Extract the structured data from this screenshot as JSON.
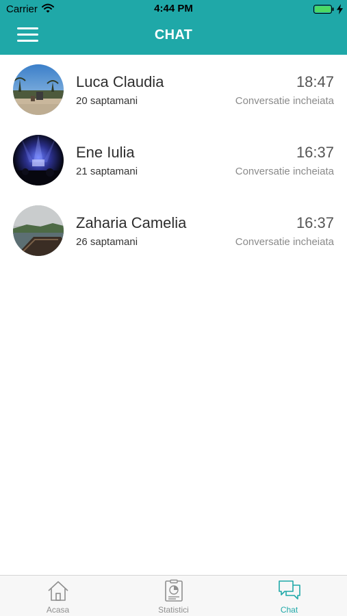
{
  "status_bar": {
    "carrier": "Carrier",
    "time": "4:44 PM"
  },
  "nav": {
    "title": "CHAT",
    "menu_icon": "hamburger-menu-icon"
  },
  "chats": [
    {
      "name": "Luca Claudia",
      "weeks": "20 saptamani",
      "time": "18:47",
      "status": "Conversatie incheiata",
      "avatar": "beach-photo"
    },
    {
      "name": "Ene Iulia",
      "weeks": "21 saptamani",
      "time": "16:37",
      "status": "Conversatie incheiata",
      "avatar": "concert-photo"
    },
    {
      "name": "Zaharia Camelia",
      "weeks": "26 saptamani",
      "time": "16:37",
      "status": "Conversatie incheiata",
      "avatar": "boat-photo"
    }
  ],
  "tabs": [
    {
      "label": "Acasa",
      "icon": "home-icon",
      "active": false
    },
    {
      "label": "Statistici",
      "icon": "stats-icon",
      "active": false
    },
    {
      "label": "Chat",
      "icon": "chat-icon",
      "active": true
    }
  ],
  "colors": {
    "accent": "#1fa8a8",
    "tab_inactive": "#8e8e8e",
    "battery": "#4cd964"
  }
}
